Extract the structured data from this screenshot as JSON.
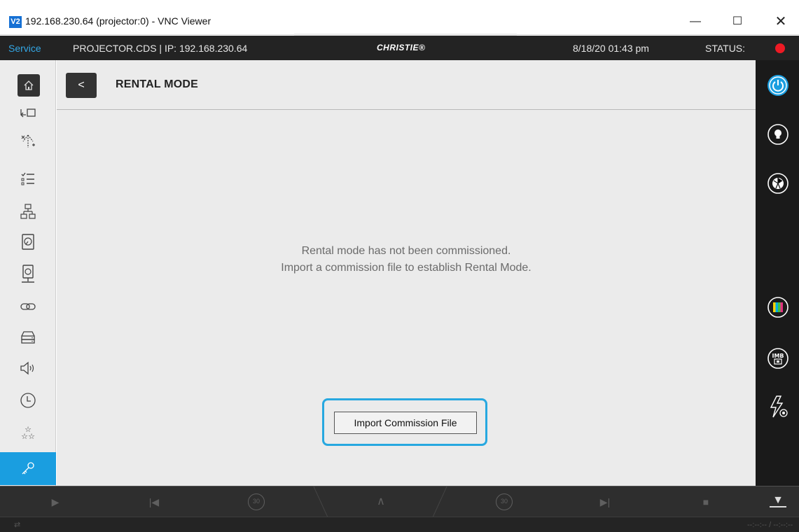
{
  "window": {
    "logo_text": "V2",
    "title": "192.168.230.64 (projector:0) - VNC Viewer",
    "min_glyph": "—",
    "max_glyph": "☐",
    "close_glyph": "✕"
  },
  "header": {
    "mode": "Service",
    "projector_info": "PROJECTOR.CDS | IP: 192.168.230.64",
    "brand": "CHRISTIE®",
    "datetime": "8/18/20  01:43 pm",
    "status_label": "STATUS:",
    "status_color": "#ee1a24"
  },
  "left_nav": [
    {
      "icon": "home-icon"
    },
    {
      "icon": "display-icon"
    },
    {
      "icon": "light-sparkle-icon"
    },
    {
      "icon": "checklist-icon"
    },
    {
      "icon": "network-icon"
    },
    {
      "icon": "hard-drive-icon"
    },
    {
      "icon": "network-drive-icon"
    },
    {
      "icon": "link-icon"
    },
    {
      "icon": "server-icon"
    },
    {
      "icon": "speaker-icon"
    },
    {
      "icon": "clock-icon"
    },
    {
      "icon": "stars-icon"
    },
    {
      "icon": "key-icon",
      "active": true
    }
  ],
  "right_nav": [
    {
      "icon": "power-icon",
      "color": "#1a9ee0"
    },
    {
      "icon": "lamp-icon"
    },
    {
      "icon": "shutter-icon"
    },
    {
      "icon": "test-pattern-icon"
    },
    {
      "icon": "imb-icon",
      "label": "IMB"
    },
    {
      "icon": "power-settings-icon"
    }
  ],
  "page": {
    "back_glyph": "<",
    "title": "RENTAL MODE",
    "message_line1": "Rental mode has not been commissioned.",
    "message_line2": "Import a commission file to establish Rental Mode.",
    "import_button": "Import Commission File"
  },
  "transport": {
    "play": "▶",
    "skip_back": "|◀",
    "rewind_30": "30",
    "up": "∧",
    "forward_30": "30",
    "skip_forward": "▶|",
    "stop": "■",
    "eject": "▼"
  },
  "statusbar": {
    "left_icon": "⇄",
    "time": "--:--:-- / --:--:--"
  },
  "colors": {
    "accent": "#1a9ee0",
    "header_bg": "#232323",
    "content_bg": "#ebebeb"
  }
}
